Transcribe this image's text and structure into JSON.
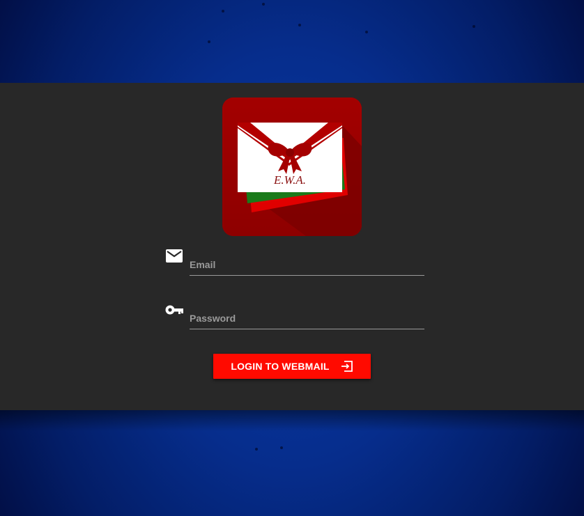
{
  "logo": {
    "text": "E.W.A.",
    "description": "red tile with white envelope and red ribbon bow"
  },
  "login_form": {
    "email": {
      "icon": "email-icon",
      "placeholder": "Email",
      "value": ""
    },
    "password": {
      "icon": "key-icon",
      "placeholder": "Password",
      "value": ""
    },
    "submit": {
      "label": "LOGIN TO WEBMAIL",
      "icon": "login-icon"
    }
  },
  "colors": {
    "panel": "#282828",
    "button": "#ff0a00",
    "logo_tile": "#980000",
    "background": "#062d8c"
  }
}
